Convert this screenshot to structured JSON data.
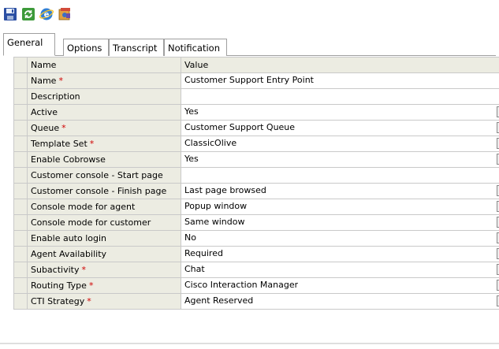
{
  "toolbar": {
    "buttons": [
      {
        "name": "save",
        "icon": "floppy-disk-icon"
      },
      {
        "name": "refresh",
        "icon": "refresh-icon"
      },
      {
        "name": "browser",
        "icon": "ie-browser-icon"
      },
      {
        "name": "properties",
        "icon": "properties-icon"
      }
    ]
  },
  "tabs": [
    {
      "label": "General",
      "active": true
    },
    {
      "label": "Options",
      "active": false
    },
    {
      "label": "Transcript",
      "active": false
    },
    {
      "label": "Notification",
      "active": false
    }
  ],
  "grid": {
    "headers": {
      "name": "Name",
      "value": "Value"
    },
    "rows": [
      {
        "label": "Name",
        "required": true,
        "value": "Customer Support Entry Point",
        "control": "none"
      },
      {
        "label": "Description",
        "required": false,
        "value": "",
        "control": "none"
      },
      {
        "label": "Active",
        "required": false,
        "value": "Yes",
        "control": "dropdown"
      },
      {
        "label": "Queue",
        "required": true,
        "value": "Customer Support Queue",
        "control": "ellipsis"
      },
      {
        "label": "Template Set",
        "required": true,
        "value": "ClassicOlive",
        "control": "ellipsis"
      },
      {
        "label": "Enable Cobrowse",
        "required": false,
        "value": "Yes",
        "control": "dropdown"
      },
      {
        "label": "Customer console - Start page",
        "required": false,
        "value": "",
        "control": "none"
      },
      {
        "label": "Customer console - Finish page",
        "required": false,
        "value": "Last page browsed",
        "control": "ellipsis"
      },
      {
        "label": "Console mode for agent",
        "required": false,
        "value": "Popup window",
        "control": "dropdown"
      },
      {
        "label": "Console mode for customer",
        "required": false,
        "value": "Same window",
        "control": "dropdown"
      },
      {
        "label": "Enable auto login",
        "required": false,
        "value": "No",
        "control": "dropdown"
      },
      {
        "label": "Agent Availability",
        "required": false,
        "value": "Required",
        "control": "dropdown"
      },
      {
        "label": "Subactivity",
        "required": true,
        "value": "Chat",
        "control": "dropdown"
      },
      {
        "label": "Routing Type",
        "required": true,
        "value": "Cisco Interaction Manager",
        "control": "dropdown"
      },
      {
        "label": "CTI Strategy",
        "required": true,
        "value": "Agent Reserved",
        "control": "dropdown"
      }
    ]
  },
  "required_marker": "*",
  "colors": {
    "required": "#d00000",
    "label_bg": "#ecece2",
    "grid_border": "#c9c9c9"
  }
}
